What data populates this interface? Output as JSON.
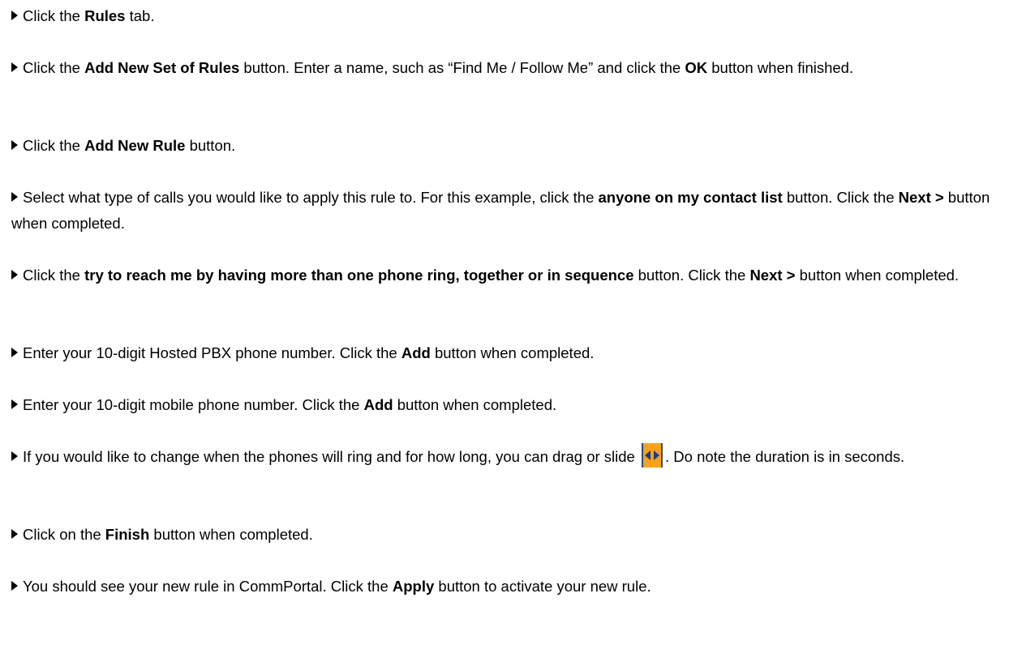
{
  "steps": [
    {
      "parts": [
        "Click the ",
        "Rules",
        " tab."
      ]
    },
    {
      "parts": [
        "Click the ",
        "Add New Set of Rules",
        " button.  Enter a name, such as “Find Me / Follow Me” and click the ",
        "OK",
        " button when finished."
      ]
    },
    {
      "parts": [
        "Click the ",
        "Add New Rule",
        " button."
      ]
    },
    {
      "parts": [
        "Select what type of calls you would like to apply this rule to.  For this example, click the ",
        "anyone on my contact list",
        " button.  Click the ",
        "Next >",
        " button when completed."
      ]
    },
    {
      "parts": [
        "Click the ",
        "try to reach me by having more than one phone ring, together or in sequence",
        " button.  Click the ",
        "Next >",
        " button when completed."
      ]
    },
    {
      "parts": [
        "Enter your 10-digit Hosted PBX phone number.  Click the ",
        "Add",
        " button when completed."
      ]
    },
    {
      "parts": [
        "Enter your 10-digit mobile phone number.  Click the ",
        "Add",
        " button when completed."
      ]
    },
    {
      "parts": [
        "If you would like to change when the phones will ring and for how long, you can drag or slide ",
        ".  Do note the duration is in seconds."
      ],
      "icon": "slider-handle-icon",
      "icon_colors": {
        "fill": "#f7a21b",
        "arrows": "#1b3b8c"
      }
    },
    {
      "parts": [
        "Click on the ",
        "Finish",
        " button when completed."
      ]
    },
    {
      "parts": [
        "You should see your new rule in CommPortal.  Click the ",
        "Apply",
        " button to activate your new rule."
      ]
    }
  ]
}
